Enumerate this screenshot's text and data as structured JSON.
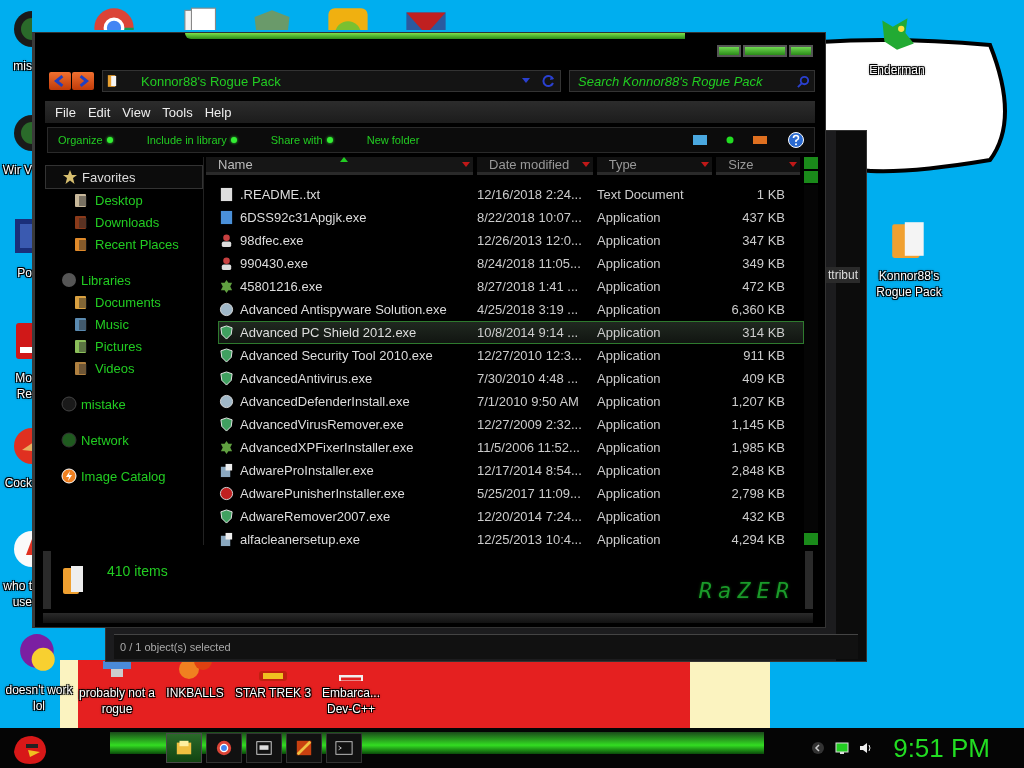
{
  "desktop": {
    "icons": [
      {
        "label": "mis",
        "kind": "disc"
      },
      {
        "label": "Wir V",
        "kind": "disc"
      },
      {
        "label": "Po",
        "kind": "blue-square"
      },
      {
        "label": "Mo Re",
        "kind": "red-book"
      },
      {
        "label": "Cock",
        "kind": "red-circle"
      },
      {
        "label": "who t use",
        "kind": "white-circle"
      },
      {
        "label": "doesn't work lol",
        "kind": "yahoo"
      },
      {
        "label": "probably not a rogue",
        "kind": "computer"
      },
      {
        "label": "INKBALLS",
        "kind": "inkballs"
      },
      {
        "label": "STAR TREK 3",
        "kind": "startrek"
      },
      {
        "label": "Embarca... Dev-C++",
        "kind": "cpp"
      },
      {
        "label": "Enderman",
        "kind": "dragon"
      },
      {
        "label": "Konnor88's Rogue Pack",
        "kind": "folder"
      }
    ]
  },
  "back_window": {
    "column_header": "ttribut",
    "status": "0 / 1 object(s) selected"
  },
  "window": {
    "address": "Konnor88's Rogue Pack",
    "search": {
      "placeholder": "Search Konnor88's Rogue Pack"
    },
    "menu": [
      "File",
      "Edit",
      "View",
      "Tools",
      "Help"
    ],
    "commands": [
      {
        "label": "Organize",
        "dropdown": true
      },
      {
        "label": "Include in library",
        "dropdown": true
      },
      {
        "label": "Share with",
        "dropdown": true
      },
      {
        "label": "New folder",
        "dropdown": false
      }
    ],
    "nav": [
      {
        "label": "Favorites",
        "kind": "star",
        "selected": true,
        "children": [
          {
            "label": "Desktop",
            "kind": "desktop",
            "selected": false
          },
          {
            "label": "Downloads",
            "kind": "downloads",
            "selected": false
          },
          {
            "label": "Recent Places",
            "kind": "recent",
            "selected": false
          }
        ]
      },
      {
        "label": "Libraries",
        "kind": "library",
        "selected": false,
        "children": [
          {
            "label": "Documents",
            "kind": "documents",
            "selected": false
          },
          {
            "label": "Music",
            "kind": "music",
            "selected": false
          },
          {
            "label": "Pictures",
            "kind": "pictures",
            "selected": false
          },
          {
            "label": "Videos",
            "kind": "videos",
            "selected": false
          }
        ]
      },
      {
        "label": "mistake",
        "kind": "orb",
        "selected": false
      },
      {
        "label": "Network",
        "kind": "network",
        "selected": false
      },
      {
        "label": "Image Catalog",
        "kind": "catalog",
        "selected": false
      }
    ],
    "columns": [
      {
        "label": "Name",
        "sorted": true
      },
      {
        "label": "Date modified",
        "sorted": false
      },
      {
        "label": "Type",
        "sorted": false
      },
      {
        "label": "Size",
        "sorted": false
      }
    ],
    "rows": [
      {
        "name": ".README..txt",
        "date": "12/16/2018 2:24...",
        "type": "Text Document",
        "size": "1 KB",
        "kind": "text",
        "selected": false
      },
      {
        "name": "6DSS92c31Apgjk.exe",
        "date": "8/22/2018 10:07...",
        "type": "Application",
        "size": "437 KB",
        "kind": "window",
        "selected": false
      },
      {
        "name": "98dfec.exe",
        "date": "12/26/2013 12:0...",
        "type": "Application",
        "size": "347 KB",
        "kind": "person",
        "selected": false
      },
      {
        "name": "990430.exe",
        "date": "8/24/2018 11:05...",
        "type": "Application",
        "size": "349 KB",
        "kind": "person",
        "selected": false
      },
      {
        "name": "45801216.exe",
        "date": "8/27/2018 1:41 ...",
        "type": "Application",
        "size": "472 KB",
        "kind": "gear",
        "selected": false
      },
      {
        "name": "Advanced Antispyware Solution.exe",
        "date": "4/25/2018 3:19 ...",
        "type": "Application",
        "size": "6,360 KB",
        "kind": "globe",
        "selected": false
      },
      {
        "name": "Advanced PC Shield 2012.exe",
        "date": "10/8/2014 9:14 ...",
        "type": "Application",
        "size": "314 KB",
        "kind": "shield",
        "selected": true
      },
      {
        "name": "Advanced Security Tool 2010.exe",
        "date": "12/27/2010 12:3...",
        "type": "Application",
        "size": "911 KB",
        "kind": "shield",
        "selected": false
      },
      {
        "name": "AdvancedAntivirus.exe",
        "date": "7/30/2010 4:48 ...",
        "type": "Application",
        "size": "409 KB",
        "kind": "shield",
        "selected": false
      },
      {
        "name": "AdvancedDefenderInstall.exe",
        "date": "7/1/2010 9:50 AM",
        "type": "Application",
        "size": "1,207 KB",
        "kind": "globe",
        "selected": false
      },
      {
        "name": "AdvancedVirusRemover.exe",
        "date": "12/27/2009 2:32...",
        "type": "Application",
        "size": "1,145 KB",
        "kind": "shield",
        "selected": false
      },
      {
        "name": "AdvancedXPFixerInstaller.exe",
        "date": "11/5/2006 11:52...",
        "type": "Application",
        "size": "1,985 KB",
        "kind": "gear",
        "selected": false
      },
      {
        "name": "AdwareProInstaller.exe",
        "date": "12/17/2014 8:54...",
        "type": "Application",
        "size": "2,848 KB",
        "kind": "installer",
        "selected": false
      },
      {
        "name": "AdwarePunisherInstaller.exe",
        "date": "5/25/2017 11:09...",
        "type": "Application",
        "size": "2,798 KB",
        "kind": "error",
        "selected": false
      },
      {
        "name": "AdwareRemover2007.exe",
        "date": "12/20/2014 7:24...",
        "type": "Application",
        "size": "432 KB",
        "kind": "shield",
        "selected": false
      },
      {
        "name": "alfacleanersetup.exe",
        "date": "12/25/2013 10:4...",
        "type": "Application",
        "size": "4,294 KB",
        "kind": "installer",
        "selected": false
      }
    ],
    "details": {
      "count": "410 items",
      "logo": "RaZER"
    }
  },
  "taskbar": {
    "buttons": [
      {
        "kind": "explorer",
        "active": true
      },
      {
        "kind": "chrome",
        "active": false
      },
      {
        "kind": "zip",
        "active": false
      },
      {
        "kind": "game",
        "active": false
      },
      {
        "kind": "console",
        "active": false
      }
    ],
    "clock": "9:51 PM"
  }
}
